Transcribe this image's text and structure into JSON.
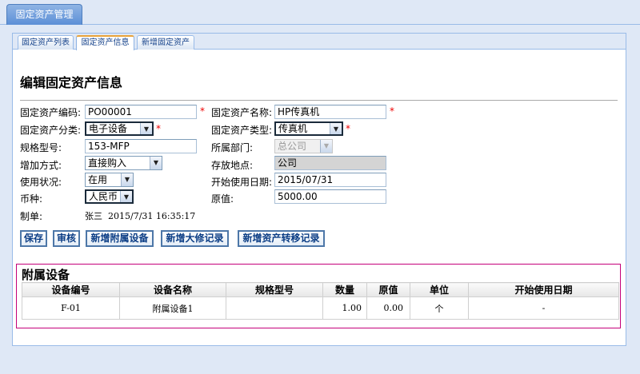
{
  "outer_tab": {
    "label": "固定资产管理"
  },
  "inner_tabs": [
    {
      "label": "固定资产列表"
    },
    {
      "label": "固定资产信息"
    },
    {
      "label": "新增固定资产"
    }
  ],
  "form": {
    "title": "编辑固定资产信息",
    "asset_code": {
      "label": "固定资产编码:",
      "value": "PO00001",
      "required": "*"
    },
    "asset_name": {
      "label": "固定资产名称:",
      "value": "HP传真机",
      "required": "*"
    },
    "asset_category": {
      "label": "固定资产分类:",
      "value": "电子设备",
      "required": "*"
    },
    "asset_type": {
      "label": "固定资产类型:",
      "value": "传真机",
      "required": "*"
    },
    "spec_model": {
      "label": "规格型号:",
      "value": "153-MFP"
    },
    "department": {
      "label": "所属部门:",
      "value": "总公司"
    },
    "add_method": {
      "label": "增加方式:",
      "value": "直接购入"
    },
    "location": {
      "label": "存放地点:",
      "value": "公司"
    },
    "usage_status": {
      "label": "使用状况:",
      "value": "在用"
    },
    "start_date": {
      "label": "开始使用日期:",
      "value": "2015/07/31"
    },
    "currency": {
      "label": "币种:",
      "value": "人民币"
    },
    "original_value": {
      "label": "原值:",
      "value": "5000.00"
    },
    "creator": {
      "label": "制单:",
      "value": "张三  2015/7/31 16:35:17"
    }
  },
  "buttons": {
    "save": "保存",
    "audit": "审核",
    "add_accessory": "新增附属设备",
    "add_repair": "新增大修记录",
    "add_transfer": "新增资产转移记录"
  },
  "accessory": {
    "title": "附属设备",
    "columns": [
      "设备编号",
      "设备名称",
      "规格型号",
      "数量",
      "原值",
      "单位",
      "开始使用日期"
    ],
    "rows": [
      [
        "F-01",
        "附属设备1",
        "",
        "1.00",
        "0.00",
        "个",
        "-"
      ]
    ]
  },
  "icons": {
    "dropdown": "chevron-down-icon"
  }
}
